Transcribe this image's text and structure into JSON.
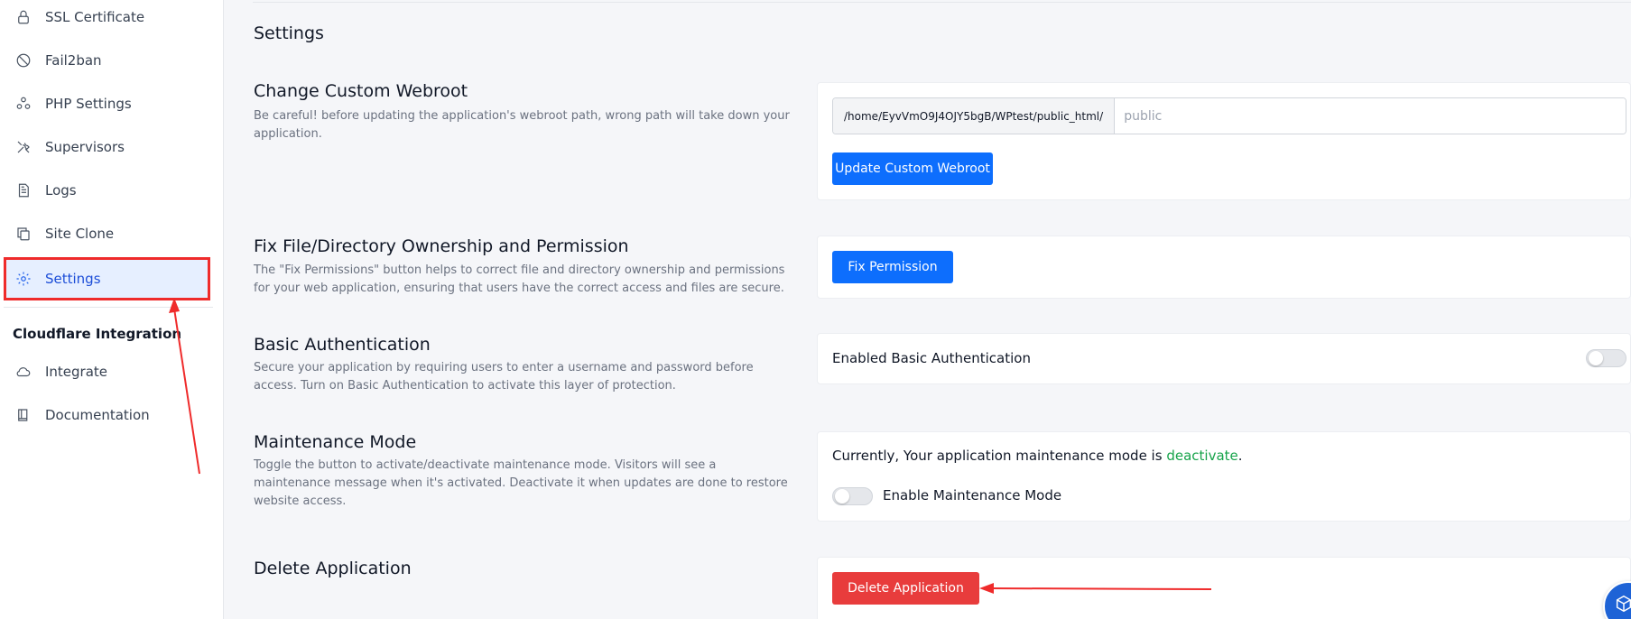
{
  "sidebar": {
    "items": [
      {
        "label": "SSL Certificate",
        "icon": "lock-icon"
      },
      {
        "label": "Fail2ban",
        "icon": "ban-icon"
      },
      {
        "label": "PHP Settings",
        "icon": "php-icon"
      },
      {
        "label": "Supervisors",
        "icon": "tools-icon"
      },
      {
        "label": "Logs",
        "icon": "document-icon"
      },
      {
        "label": "Site Clone",
        "icon": "copy-icon"
      },
      {
        "label": "Settings",
        "icon": "gear-icon",
        "active": true
      }
    ],
    "group_title": "Cloudflare Integration",
    "group_items": [
      {
        "label": "Integrate",
        "icon": "cloud-icon"
      },
      {
        "label": "Documentation",
        "icon": "book-icon"
      }
    ]
  },
  "main": {
    "title": "Settings",
    "webroot": {
      "title": "Change Custom Webroot",
      "description": "Be careful! before updating the application's webroot path, wrong path will take down your application.",
      "prefix": "/home/EyvVmO9J4OJY5bgB/WPtest/public_html/",
      "placeholder": "public",
      "button": "Update Custom Webroot"
    },
    "permission": {
      "title": "Fix File/Directory Ownership and Permission",
      "description": "The \"Fix Permissions\" button helps to correct file and directory ownership and permissions for your web application, ensuring that users have the correct access and files are secure.",
      "button": "Fix Permission"
    },
    "basic_auth": {
      "title": "Basic Authentication",
      "description": "Secure your application by requiring users to enter a username and password before access. Turn on Basic Authentication to activate this layer of protection.",
      "label": "Enabled Basic Authentication",
      "enabled": false
    },
    "maintenance": {
      "title": "Maintenance Mode",
      "description": "Toggle the button to activate/deactivate maintenance mode. Visitors will see a maintenance message when it's activated. Deactivate it when updates are done to restore website access.",
      "status_prefix": "Currently, Your application maintenance mode is",
      "status_value": "deactivate",
      "status_suffix": ".",
      "toggle_label": "Enable Maintenance Mode",
      "enabled": false
    },
    "delete": {
      "title": "Delete Application",
      "button": "Delete Application"
    }
  },
  "colors": {
    "accent": "#0d6efd",
    "danger": "#e83c3c",
    "status_green": "#16a34a",
    "annotation_red": "#ef2b2b"
  }
}
